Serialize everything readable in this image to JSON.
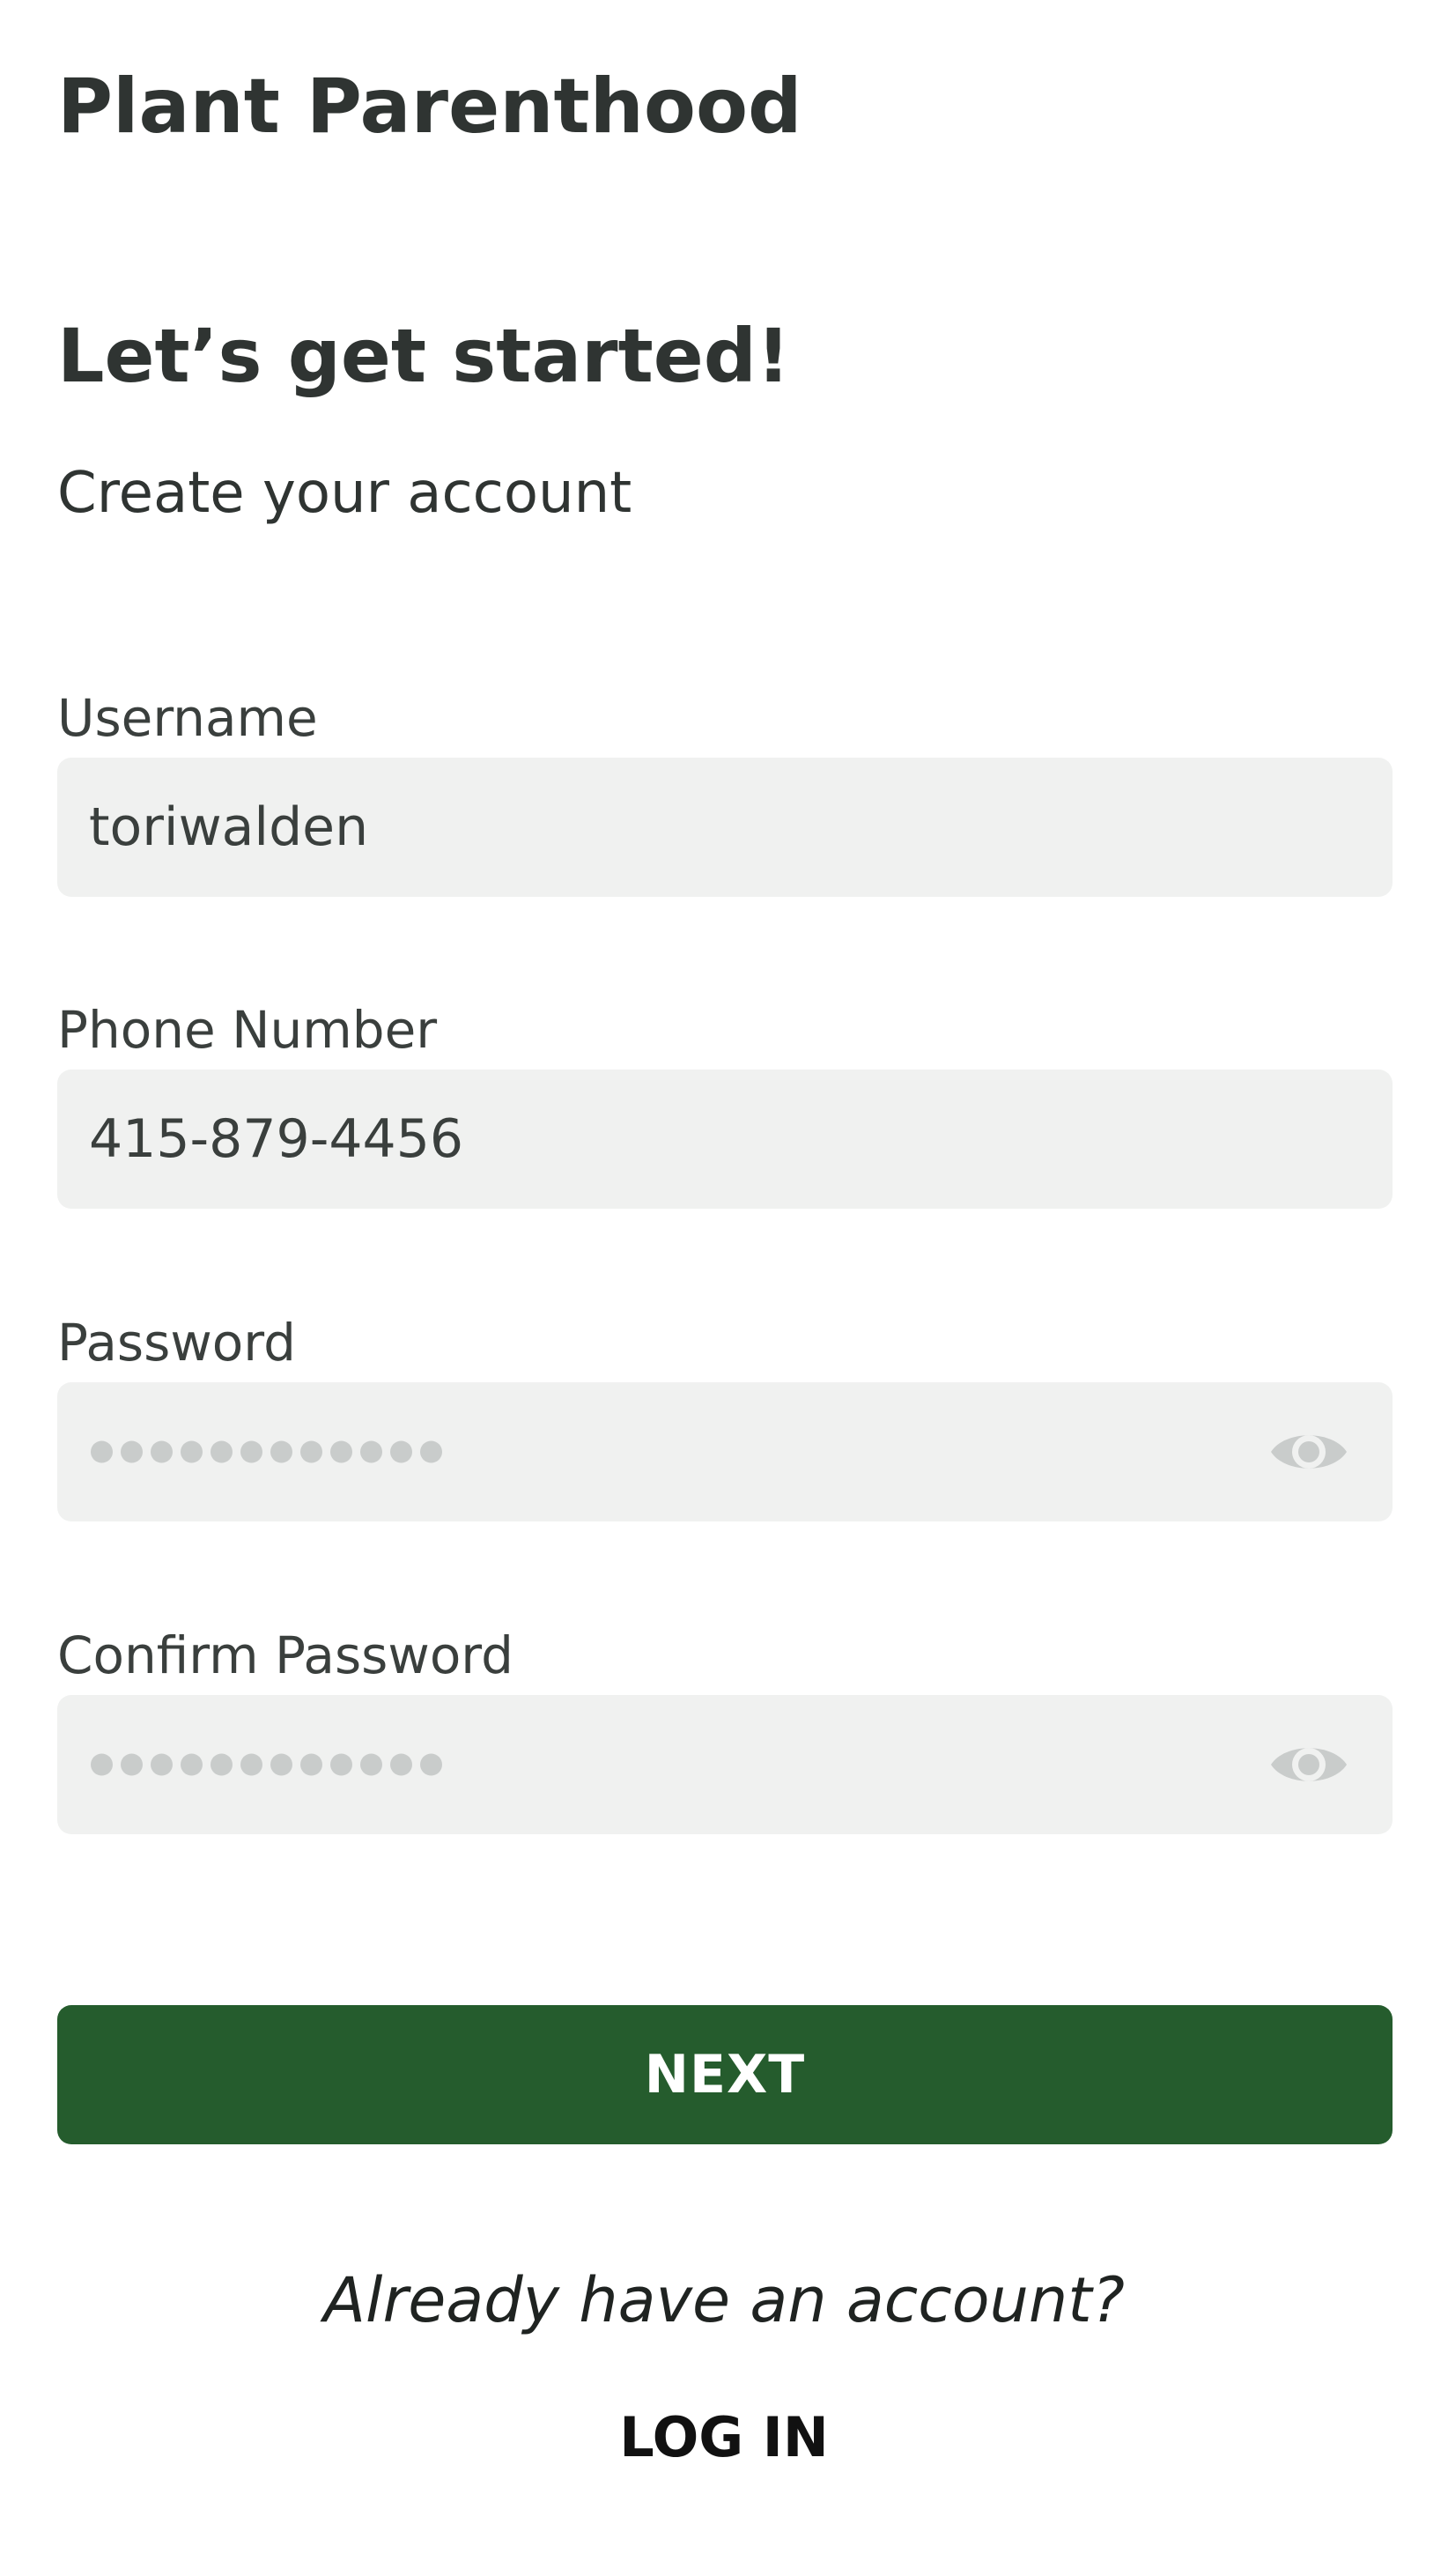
{
  "app": {
    "title": "Plant Parenthood"
  },
  "header": {
    "heading": "Let’s get started!",
    "subheading": "Create your account"
  },
  "form": {
    "username": {
      "label": "Username",
      "value": "toriwalden"
    },
    "phone": {
      "label": "Phone Number",
      "value": "415-879-4456"
    },
    "password": {
      "label": "Password",
      "masked_length": 12,
      "visibility_icon": "eye-icon"
    },
    "confirm_password": {
      "label": "Confirm Password",
      "masked_length": 12,
      "visibility_icon": "eye-icon"
    }
  },
  "actions": {
    "next_label": "NEXT",
    "already_text": "Already have an account?",
    "login_label": "LOG IN"
  },
  "colors": {
    "primary": "#255c2d",
    "field_bg": "#f0f1f0",
    "text": "#2f3432",
    "mask_dot": "#c9cccb"
  }
}
